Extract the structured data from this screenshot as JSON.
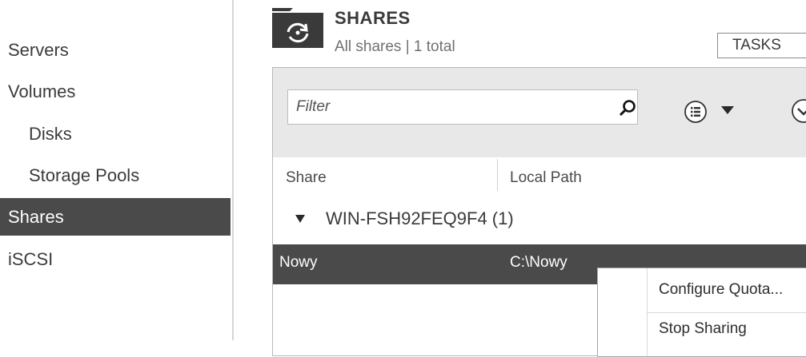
{
  "sidebar": {
    "items": [
      {
        "label": "Servers"
      },
      {
        "label": "Volumes"
      },
      {
        "label": "Disks"
      },
      {
        "label": "Storage Pools"
      },
      {
        "label": "Shares"
      },
      {
        "label": "iSCSI"
      }
    ],
    "active": "Shares"
  },
  "header": {
    "title": "SHARES",
    "subtitle": "All shares | 1 total",
    "tasks_label": "TASKS"
  },
  "toolbar": {
    "filter_placeholder": "Filter",
    "icons": [
      "search-icon",
      "list-view-icon",
      "dropdown-arrow-icon",
      "expand-circle-icon"
    ]
  },
  "table": {
    "columns": [
      "Share",
      "Local Path"
    ],
    "group": {
      "label": "WIN-FSH92FEQ9F4 (1)"
    },
    "rows": [
      {
        "share": "Nowy",
        "local_path": "C:\\Nowy",
        "selected": true
      }
    ]
  },
  "context_menu": {
    "items": [
      {
        "label": "Configure Quota..."
      },
      {
        "label": "Stop Sharing"
      }
    ]
  },
  "colors": {
    "selection": "#4a4a4a",
    "toolbar_bg": "#e8e8e8",
    "text": "#3a3a3a"
  }
}
